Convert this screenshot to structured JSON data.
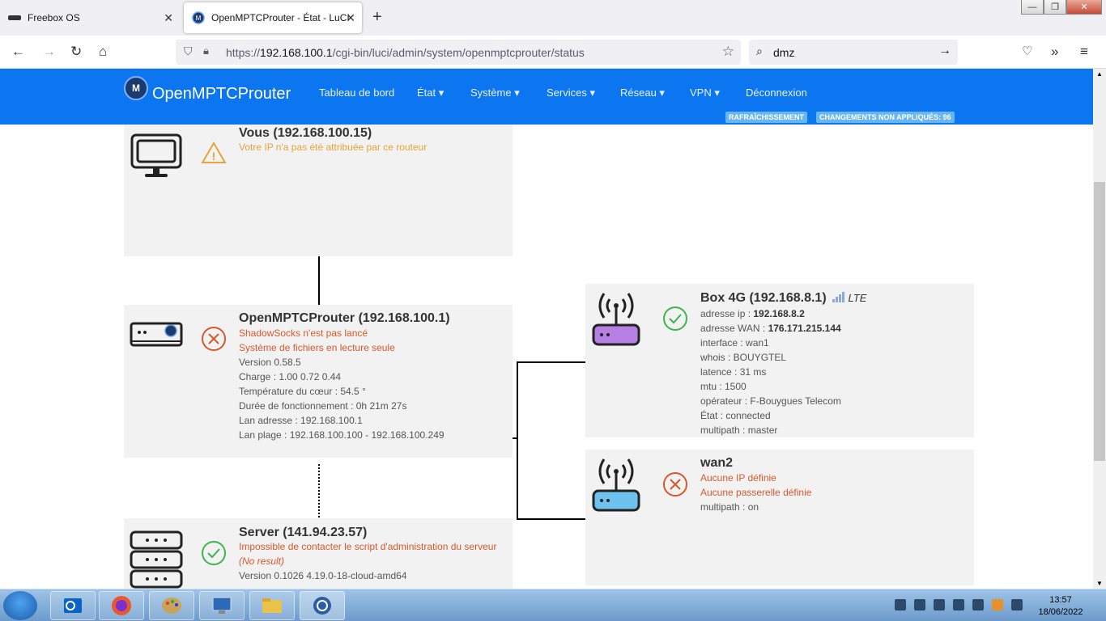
{
  "tabs": [
    {
      "label": "Freebox OS"
    },
    {
      "label": "OpenMPTCProuter - État - LuCI"
    }
  ],
  "url": {
    "scheme": "https://",
    "host": "192.168.100.1",
    "path": "/cgi-bin/luci/admin/system/openmptcprouter/status"
  },
  "search": {
    "value": "dmz"
  },
  "app": {
    "brand": "OpenMPTCProuter",
    "menu": [
      "Tableau de bord",
      "État",
      "Système",
      "Services",
      "Réseau",
      "VPN",
      "Déconnexion"
    ],
    "badges": [
      "RAFRAÎCHISSEMENT",
      "CHANGEMENTS NON APPLIQUÉS: 96"
    ]
  },
  "diagram": {
    "client": {
      "title": "Vous (192.168.100.15)",
      "warning": "Votre IP n'a pas été attribuée par ce routeur"
    },
    "router": {
      "title": "OpenMPTCProuter (192.168.100.1)",
      "errors": [
        "ShadowSocks n'est pas lancé",
        "Système de fichiers en lecture seule"
      ],
      "lines": [
        "Version 0.58.5",
        "Charge : 1.00 0.72 0.44",
        "Température du cœur : 54.5 °",
        "Durée de fonctionnement : 0h 21m 27s",
        "Lan adresse : 192.168.100.1",
        "Lan plage : 192.168.100.100 - 192.168.100.249"
      ]
    },
    "server": {
      "title": "Server (141.94.23.57)",
      "error": "Impossible de contacter le script d'administration du serveur",
      "result": "(No result)",
      "version": "Version 0.1026 4.19.0-18-cloud-amd64"
    },
    "wan1": {
      "title": "Box 4G (192.168.8.1)",
      "network_type": "LTE",
      "ip_label": "adresse ip : ",
      "ip_value": "192.168.8.2",
      "wan_label": "adresse WAN : ",
      "wan_value": "176.171.215.144",
      "lines": [
        "interface : wan1",
        "whois : BOUYGTEL",
        "latence : 31 ms",
        "mtu : 1500",
        "opérateur : F-Bouygues Telecom",
        "État : connected",
        "multipath : master"
      ]
    },
    "wan2": {
      "title": "wan2",
      "errors": [
        "Aucune IP définie",
        "Aucune passerelle définie"
      ],
      "multipath": "multipath : on"
    }
  },
  "taskbar": {
    "time": "13:57",
    "date": "18/06/2022"
  },
  "colors": {
    "header_bg": "#0c75f0",
    "error": "#d9582a",
    "warning": "#e8a33a",
    "ok": "#3cb54a",
    "wan1_router": "#b57fe3",
    "wan2_router": "#6ec3ee"
  }
}
